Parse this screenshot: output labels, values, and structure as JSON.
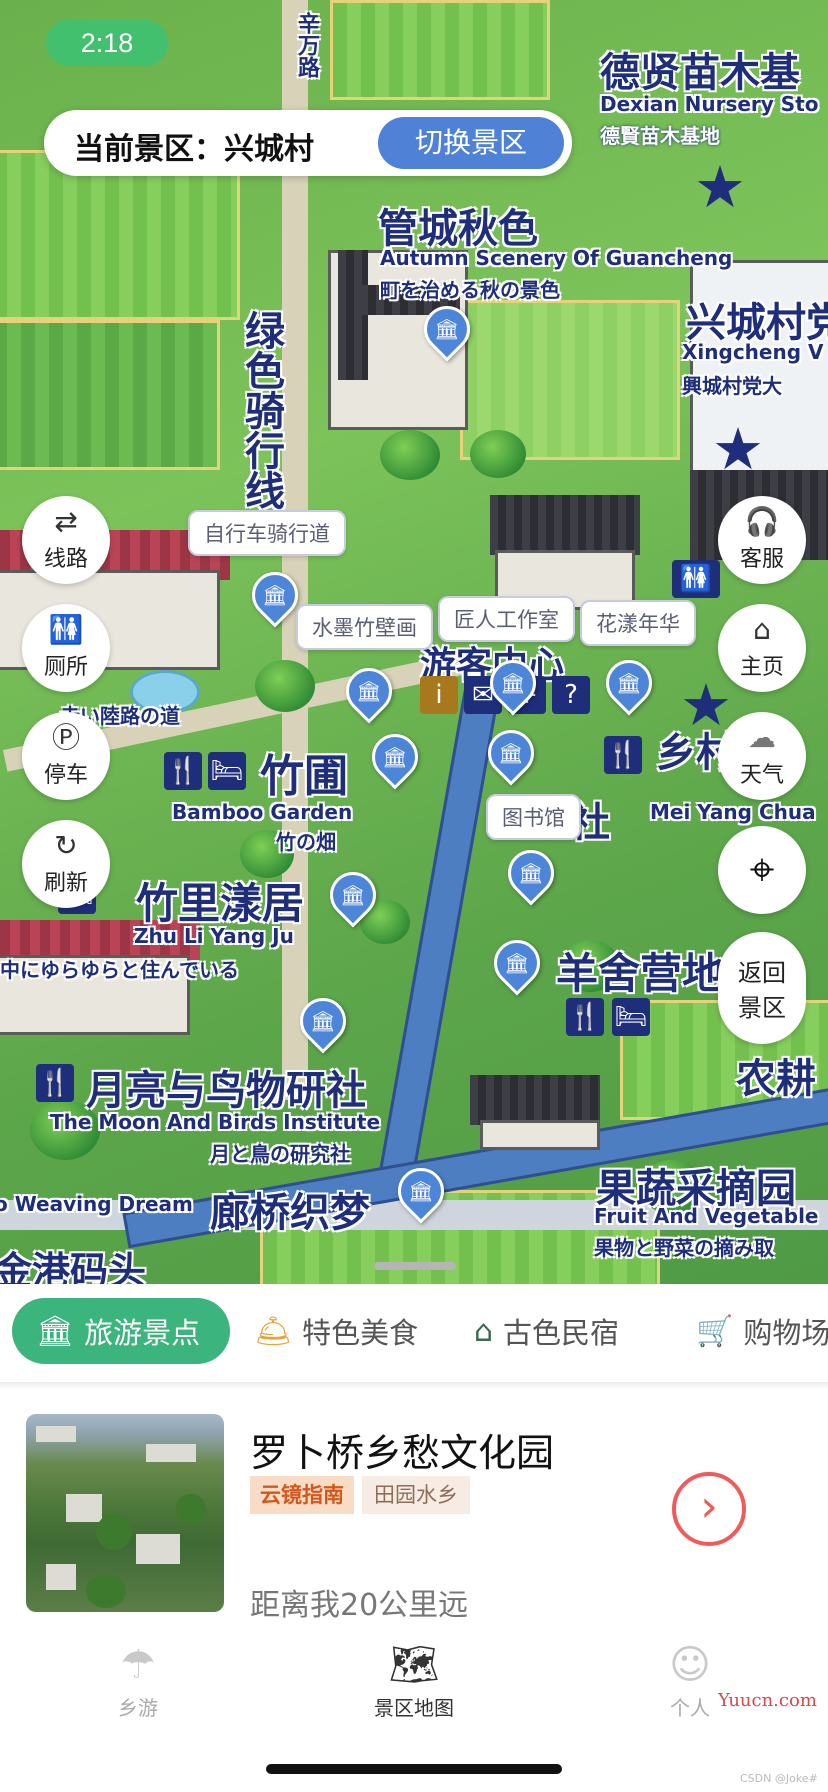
{
  "status": {
    "time": "2:18"
  },
  "scene": {
    "label": "当前景区：兴城村",
    "switch_button": "切换景区"
  },
  "map": {
    "titles": {
      "dexian": "德贤苗木基",
      "dexian_en": "Dexian Nursery Sto",
      "dexian_jp": "德賢苗木基地",
      "guancheng": "管城秋色",
      "guancheng_en": "Autumn Scenery Of Guancheng",
      "guancheng_jp": "町を治める秋の景色",
      "xingcheng": "兴城村党",
      "xingcheng_en": "Xingcheng V",
      "xingcheng_jp": "興城村党大",
      "bike_vertical": "绿色骑行线",
      "xinfang": "辛万路",
      "bamboo": "竹圃",
      "bamboo_en": "Bamboo Garden",
      "bamboo_jp": "竹の畑",
      "zhuli": "竹里漾居",
      "zhuli_en": "Zhu Li Yang Ju",
      "zhuli_jp": "中にゆらゆらと住んでいる",
      "moon": "月亮与鸟物研社",
      "moon_en": "The Moon And Birds Institute",
      "moon_jp": "月と鳥の研究社",
      "weaving": "廊桥织梦",
      "weaving_en": "o Weaving Dream",
      "jingang": "金港码头",
      "sheep": "羊舍营地",
      "meiyang_en": "Mei Yang Chua",
      "meiyang_jp": "社",
      "nonggeng": "农耕",
      "fruit": "果蔬采摘园",
      "fruit_en": "Fruit And Vegetable",
      "fruit_jp": "果物と野菜の摘み取",
      "countryside": "乡村",
      "visitor": "游客中心",
      "road_jp": "赤い陸路の道"
    },
    "bubbles": {
      "bike_path": "自行车骑行道",
      "ink_bamboo": "水墨竹壁画",
      "craftsman": "匠人工作室",
      "flower": "花漾年华",
      "library": "图书馆"
    }
  },
  "left_buttons": [
    {
      "label": "线路",
      "icon": "route-icon"
    },
    {
      "label": "厕所",
      "icon": "toilet-icon"
    },
    {
      "label": "停车",
      "icon": "parking-icon"
    },
    {
      "label": "刷新",
      "icon": "refresh-icon"
    }
  ],
  "right_buttons": [
    {
      "label": "客服",
      "icon": "service-icon"
    },
    {
      "label": "主页",
      "icon": "home-icon"
    },
    {
      "label": "天气",
      "icon": "cloud-icon"
    },
    {
      "label": "",
      "icon": "locate-icon"
    },
    {
      "label": "返回景区",
      "line1": "返回",
      "line2": "景区",
      "icon": "return-icon"
    }
  ],
  "tabs": [
    {
      "label": "旅游景点",
      "icon": "attraction-icon",
      "active": true
    },
    {
      "label": "特色美食",
      "icon": "food-icon"
    },
    {
      "label": "古色民宿",
      "icon": "homestay-icon"
    },
    {
      "label": "购物场",
      "icon": "cart-icon"
    }
  ],
  "card": {
    "title": "罗卜桥乡愁文化园",
    "tag_primary": "云镜指南",
    "tag_secondary": "田园水乡",
    "distance": "距离我20公里远"
  },
  "bottom_nav": [
    {
      "label": "乡游",
      "icon": "umbrella-icon"
    },
    {
      "label": "景区地图",
      "icon": "map-icon",
      "active": true
    },
    {
      "label": "个人",
      "icon": "person-icon"
    }
  ],
  "watermark": {
    "text": "Yuucn.com",
    "small": "CSDN @Joke#"
  },
  "colors": {
    "accent_green": "#3cb47e",
    "accent_blue": "#4f82d6",
    "map_ink": "#1f2e7a",
    "go_red": "#ef5a5a"
  }
}
